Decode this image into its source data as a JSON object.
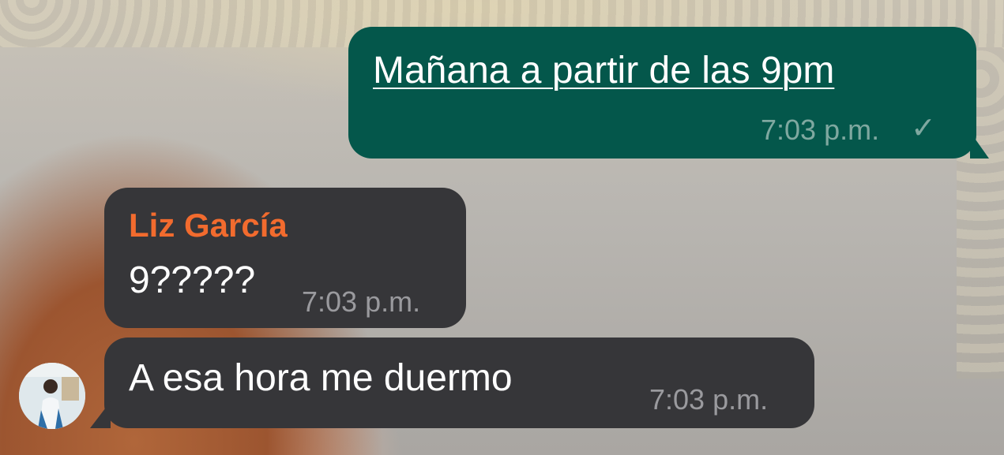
{
  "chat": {
    "messages": [
      {
        "direction": "outgoing",
        "text": "Mañana a partir de las 9pm",
        "time": "7:03 p.m.",
        "status_icon": "single-check-icon"
      },
      {
        "direction": "incoming",
        "sender": "Liz García",
        "text": "9?????",
        "time": "7:03 p.m."
      },
      {
        "direction": "incoming",
        "text": "A esa hora me duermo",
        "time": "7:03 p.m.",
        "avatar_icon": "contact-avatar-icon"
      }
    ]
  },
  "colors": {
    "outgoing_bubble": "#04574b",
    "incoming_bubble": "#363639",
    "sender_name": "#f26b2e",
    "timestamp": "#9a9a9e"
  }
}
